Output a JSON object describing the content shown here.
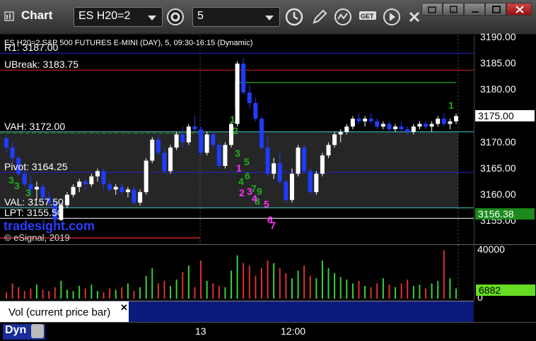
{
  "window": {
    "title": "Chart",
    "symbol": "ES H20=2",
    "interval": "5"
  },
  "chart": {
    "title": "ES H20=2  S&P 500 FUTURES E-MINI (DAY), 5, 09:30-16:15 (Dynamic)",
    "watermark": "tradesight.com",
    "copyright": "© eSignal, 2019",
    "levels": [
      {
        "name": "R1",
        "label": "R1: 3187.00",
        "price": 3187.0,
        "color": "#2222cc"
      },
      {
        "name": "UBreak",
        "label": "UBreak: 3183.75",
        "price": 3183.75,
        "color": "#cc2222"
      },
      {
        "name": "VAH",
        "label": "VAH: 3172.00",
        "price": 3172.0,
        "color": "#44cccc"
      },
      {
        "name": "Pivot",
        "label": "Pivot: 3164.25",
        "price": 3164.25,
        "color": "#2222cc"
      },
      {
        "name": "VAL",
        "label": "VAL: 3157.50",
        "price": 3157.5,
        "color": "#44cccc"
      },
      {
        "name": "LPT",
        "label": "LPT: 3155.50",
        "price": 3155.5,
        "color": "#ffffff"
      }
    ],
    "price_ticks": [
      "3190.00",
      "3185.00",
      "3180.00",
      "3175.00",
      "3170.00",
      "3165.00",
      "3160.00",
      "3155.00"
    ],
    "last_price": "3175.00",
    "low_tag": "3156.38",
    "volume_ticks": [
      "40000",
      "0"
    ],
    "volume_tag": "6882",
    "volume_legend": "Vol (current price bar)",
    "time_ticks": [
      "13",
      "12:00"
    ],
    "mode": "Dyn",
    "seq_green": [
      "1",
      "2",
      "3",
      "4",
      "5",
      "6",
      "7",
      "8",
      "9",
      "3",
      "3",
      "3"
    ],
    "seq_magenta": [
      "1",
      "2",
      "3",
      "4",
      "5",
      "6",
      "7"
    ],
    "seq_top": "1"
  },
  "chart_data": {
    "type": "candlestick",
    "y_unit": "price",
    "ylim": [
      3152,
      3191
    ],
    "candles": [
      [
        3170.8,
        3171.5,
        3168,
        3169
      ],
      [
        3169,
        3170,
        3166,
        3167
      ],
      [
        3167,
        3167.5,
        3163.5,
        3164
      ],
      [
        3164,
        3165,
        3161.5,
        3162
      ],
      [
        3162,
        3163.5,
        3160,
        3161
      ],
      [
        3161,
        3162.5,
        3159,
        3161.5
      ],
      [
        3161.5,
        3162,
        3158.5,
        3159.5
      ],
      [
        3159.5,
        3160.5,
        3157.5,
        3158.5
      ],
      [
        3158.5,
        3159,
        3154.5,
        3155.2
      ],
      [
        3155.2,
        3158.5,
        3155,
        3158
      ],
      [
        3158,
        3160.5,
        3157.5,
        3160
      ],
      [
        3160,
        3162,
        3159.5,
        3161.5
      ],
      [
        3161.5,
        3163,
        3160.5,
        3162.5
      ],
      [
        3162.5,
        3163,
        3161,
        3162
      ],
      [
        3162,
        3164,
        3161.5,
        3163.5
      ],
      [
        3163.5,
        3165,
        3162.5,
        3164.5
      ],
      [
        3164.5,
        3165,
        3161,
        3162
      ],
      [
        3162,
        3162.5,
        3160.5,
        3161
      ],
      [
        3161,
        3162,
        3160,
        3161.5
      ],
      [
        3161.5,
        3162,
        3160,
        3160.5
      ],
      [
        3160.5,
        3161.5,
        3159.5,
        3161
      ],
      [
        3161,
        3161.5,
        3158,
        3158.5
      ],
      [
        3158.5,
        3161,
        3158,
        3160.5
      ],
      [
        3160.5,
        3167,
        3160,
        3166.5
      ],
      [
        3166.5,
        3171,
        3166,
        3170.5
      ],
      [
        3170.5,
        3171.5,
        3167.5,
        3168
      ],
      [
        3168,
        3169,
        3164,
        3164.5
      ],
      [
        3164.5,
        3169.5,
        3164,
        3169
      ],
      [
        3169,
        3172,
        3168.5,
        3171.5
      ],
      [
        3171.5,
        3173,
        3169,
        3170
      ],
      [
        3170,
        3173.5,
        3169.5,
        3173
      ],
      [
        3173,
        3175,
        3172,
        3172.5
      ],
      [
        3172.5,
        3173,
        3167.5,
        3168
      ],
      [
        3168,
        3172,
        3167.5,
        3171.5
      ],
      [
        3171.5,
        3172,
        3169,
        3169.5
      ],
      [
        3169.5,
        3170,
        3165,
        3165.5
      ],
      [
        3165.5,
        3170,
        3165,
        3169.5
      ],
      [
        3169.5,
        3174,
        3169,
        3173.5
      ],
      [
        3173.5,
        3185.5,
        3173,
        3185
      ],
      [
        3185,
        3186,
        3179,
        3179.5
      ],
      [
        3179.5,
        3181,
        3176.5,
        3177.5
      ],
      [
        3177.5,
        3178.5,
        3174,
        3174.5
      ],
      [
        3174.5,
        3175,
        3168.5,
        3169
      ],
      [
        3169,
        3171,
        3163.5,
        3164
      ],
      [
        3164,
        3167,
        3163,
        3166
      ],
      [
        3166,
        3168,
        3162,
        3162.5
      ],
      [
        3162.5,
        3163,
        3158.5,
        3159
      ],
      [
        3159,
        3165,
        3158.5,
        3164
      ],
      [
        3164,
        3169.5,
        3163.5,
        3169
      ],
      [
        3169,
        3169.5,
        3164,
        3164.5
      ],
      [
        3164.5,
        3165,
        3160,
        3160.5
      ],
      [
        3160.5,
        3164.5,
        3160,
        3164
      ],
      [
        3164,
        3168,
        3163.5,
        3167.5
      ],
      [
        3167.5,
        3170,
        3167,
        3169.5
      ],
      [
        3169.5,
        3172,
        3169,
        3171.5
      ],
      [
        3171.5,
        3172.5,
        3170,
        3172
      ],
      [
        3172,
        3173.5,
        3171.5,
        3173
      ],
      [
        3173,
        3175,
        3172.5,
        3174.5
      ],
      [
        3174.5,
        3175.5,
        3173.5,
        3174
      ],
      [
        3174,
        3175,
        3173,
        3174.5
      ],
      [
        3174.5,
        3175.5,
        3173.5,
        3174
      ],
      [
        3174,
        3174.5,
        3172.5,
        3173
      ],
      [
        3173,
        3174,
        3172.5,
        3173.5
      ],
      [
        3173.5,
        3174,
        3172,
        3172.5
      ],
      [
        3172.5,
        3173.5,
        3172,
        3173
      ],
      [
        3173,
        3174,
        3172,
        3172.5
      ],
      [
        3172.5,
        3173,
        3171.5,
        3172
      ],
      [
        3172,
        3173.5,
        3171.5,
        3173
      ],
      [
        3173,
        3174,
        3172.5,
        3173.5
      ],
      [
        3173.5,
        3174,
        3172.5,
        3173
      ],
      [
        3173,
        3174,
        3172,
        3173.5
      ],
      [
        3173.5,
        3175,
        3173,
        3174.5
      ],
      [
        3174.5,
        3175.5,
        3173,
        3173.5
      ],
      [
        3173.5,
        3174.5,
        3172.5,
        3174
      ],
      [
        3174,
        3175.5,
        3173.5,
        3175
      ]
    ],
    "volume_max": 40000,
    "volume": [
      5,
      12,
      9,
      6,
      8,
      11,
      7,
      6,
      9,
      14,
      7,
      6,
      10,
      8,
      11,
      6,
      5,
      8,
      7,
      9,
      12,
      6,
      9,
      18,
      24,
      12,
      14,
      10,
      15,
      21,
      26,
      9,
      30,
      14,
      12,
      10,
      9,
      22,
      34,
      28,
      26,
      18,
      24,
      30,
      28,
      24,
      20,
      16,
      22,
      26,
      18,
      16,
      30,
      24,
      20,
      17,
      15,
      12,
      14,
      10,
      9,
      12,
      16,
      11,
      9,
      12,
      15,
      10,
      11,
      8,
      12,
      14,
      38,
      16,
      8
    ]
  }
}
